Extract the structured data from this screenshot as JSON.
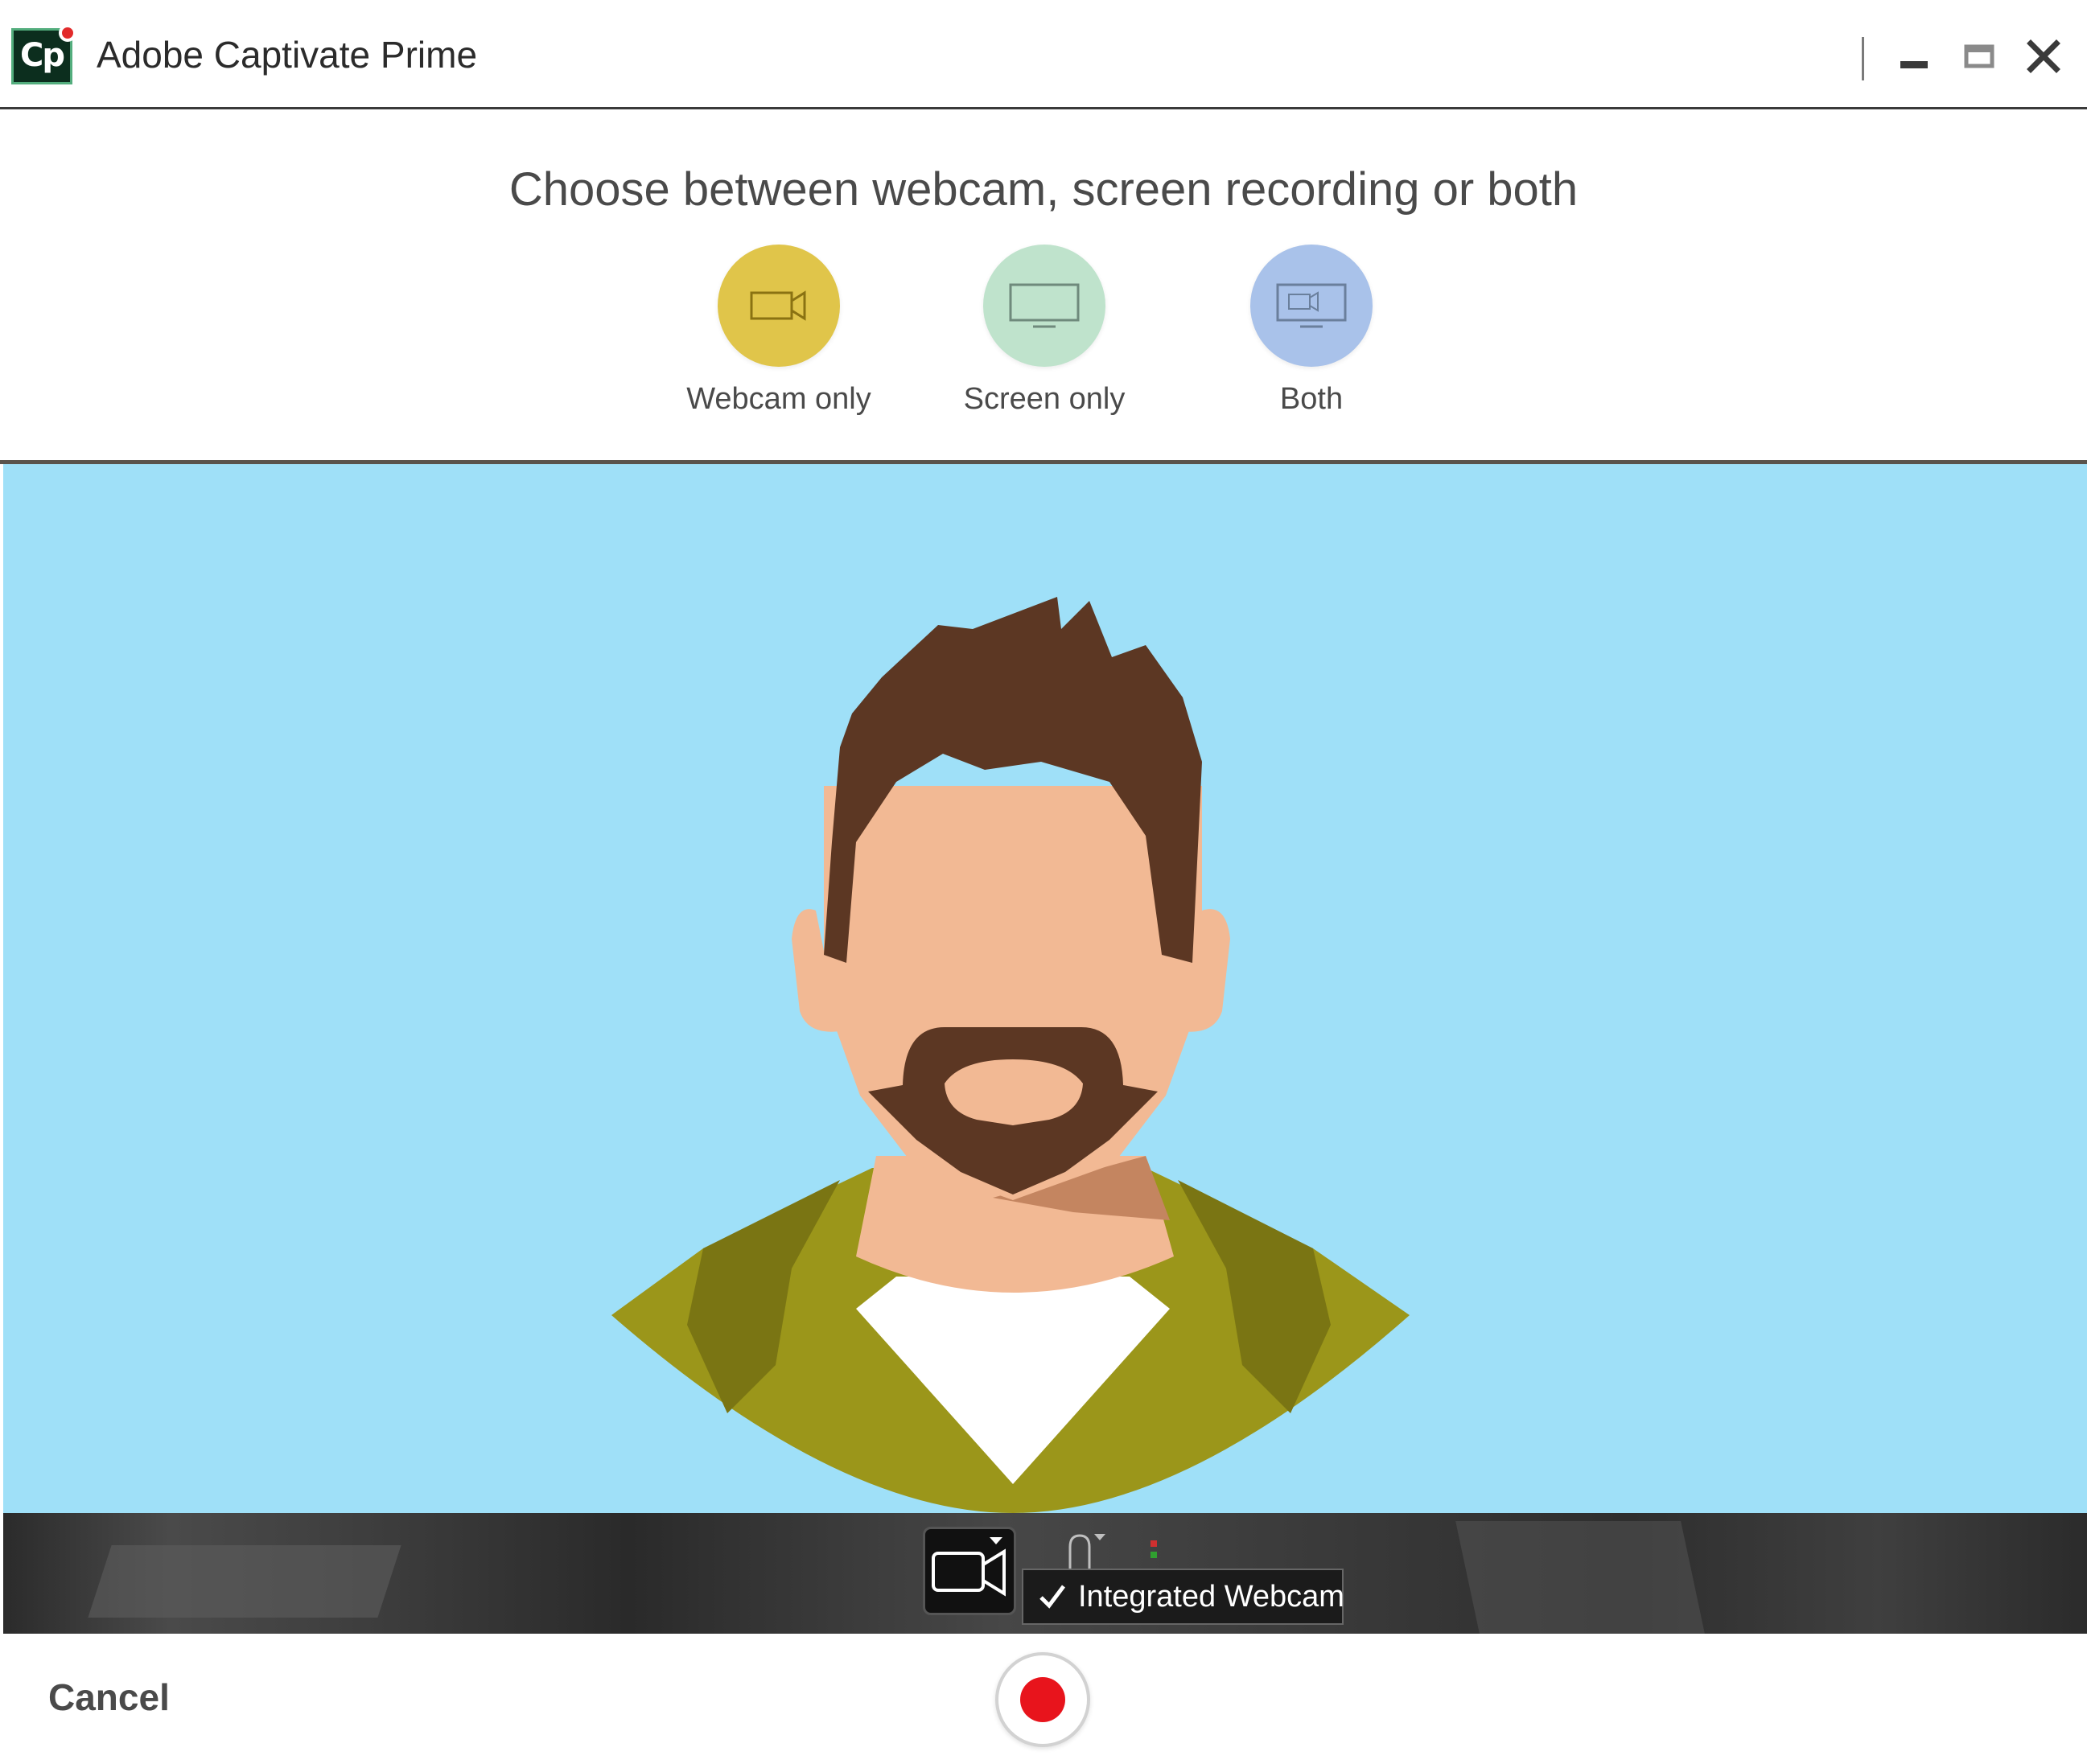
{
  "window": {
    "app_logo_text": "Cp",
    "title": "Adobe Captivate Prime",
    "controls": [
      "minimize-icon",
      "maximize-icon",
      "close-icon"
    ]
  },
  "chooser": {
    "heading": "Choose between webcam, screen recording or both",
    "options": [
      {
        "label": "Webcam only",
        "icon": "webcam-icon",
        "color": "#e0c54a"
      },
      {
        "label": "Screen only",
        "icon": "monitor-icon",
        "color": "#bfe3cc"
      },
      {
        "label": "Both",
        "icon": "monitor-webcam-icon",
        "color": "#a9c2ea"
      }
    ]
  },
  "preview": {
    "background_color": "#9fe0f8",
    "subject": "avatar-illustration"
  },
  "devices": {
    "camera_icon": "video-camera-icon",
    "mic_icon": "microphone-icon",
    "menu_items": [
      {
        "label": "Integrated Webcam",
        "selected": true
      }
    ]
  },
  "footer": {
    "cancel_label": "Cancel",
    "record_icon": "record-icon",
    "record_color": "#e8141c"
  }
}
